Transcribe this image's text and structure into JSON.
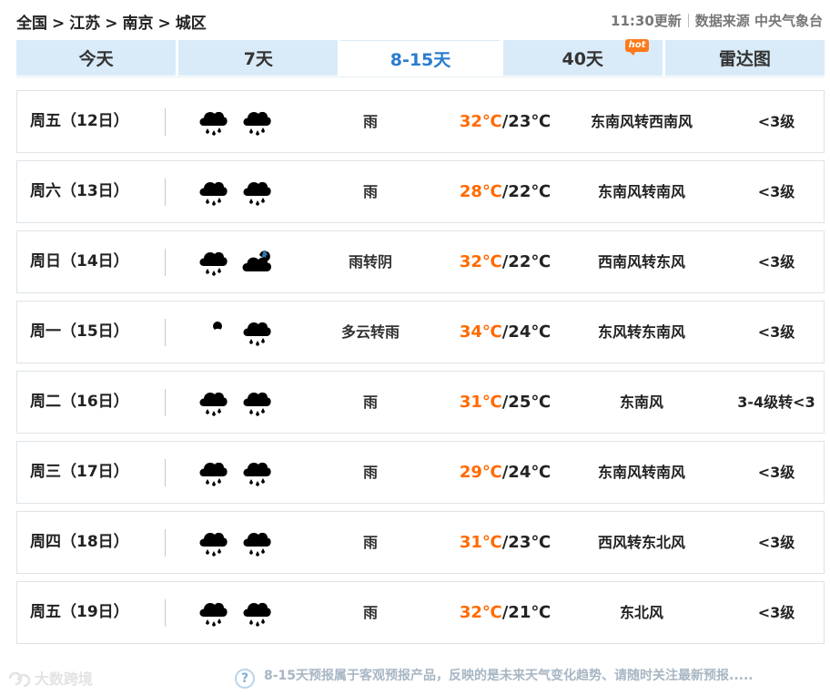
{
  "breadcrumb": {
    "items": [
      "全国",
      "江苏",
      "南京",
      "城区"
    ],
    "separator": ">"
  },
  "meta": {
    "update_time": "11:30更新",
    "source": "数据来源 中央气象台"
  },
  "tabs": [
    {
      "label": "今天",
      "active": false
    },
    {
      "label": "7天",
      "active": false
    },
    {
      "label": "8-15天",
      "active": true
    },
    {
      "label": "40天",
      "active": false,
      "badge": "hot"
    },
    {
      "label": "雷达图",
      "active": false
    }
  ],
  "forecast": [
    {
      "day": "周五（12日）",
      "icon1": "rain-icon",
      "icon2": "rain-icon",
      "desc": "雨",
      "high": "32℃",
      "low": "/23℃",
      "wind": "东南风转西南风",
      "level": "<3级"
    },
    {
      "day": "周六（13日）",
      "icon1": "rain-icon",
      "icon2": "rain-icon",
      "desc": "雨",
      "high": "28℃",
      "low": "/22℃",
      "wind": "东南风转南风",
      "level": "<3级"
    },
    {
      "day": "周日（14日）",
      "icon1": "rain-icon",
      "icon2": "overcast-icon",
      "desc": "雨转阴",
      "high": "32℃",
      "low": "/22℃",
      "wind": "西南风转东风",
      "level": "<3级"
    },
    {
      "day": "周一（15日）",
      "icon1": "partly-cloudy-icon",
      "icon2": "rain-icon",
      "desc": "多云转雨",
      "high": "34℃",
      "low": "/24℃",
      "wind": "东风转东南风",
      "level": "<3级"
    },
    {
      "day": "周二（16日）",
      "icon1": "rain-icon",
      "icon2": "rain-icon",
      "desc": "雨",
      "high": "31℃",
      "low": "/25℃",
      "wind": "东南风",
      "level": "3-4级转<3"
    },
    {
      "day": "周三（17日）",
      "icon1": "rain-icon",
      "icon2": "rain-icon",
      "desc": "雨",
      "high": "29℃",
      "low": "/24℃",
      "wind": "东南风转南风",
      "level": "<3级"
    },
    {
      "day": "周四（18日）",
      "icon1": "rain-icon",
      "icon2": "rain-icon",
      "desc": "雨",
      "high": "31℃",
      "low": "/23℃",
      "wind": "西风转东北风",
      "level": "<3级"
    },
    {
      "day": "周五（19日）",
      "icon1": "rain-icon",
      "icon2": "rain-icon",
      "desc": "雨",
      "high": "32℃",
      "low": "/21℃",
      "wind": "东北风",
      "level": "<3级"
    }
  ],
  "footer": {
    "help_icon": "?",
    "note": "8-15天预报属于客观预报产品，反映的是未来天气变化趋势、请随时关注最新预报.....",
    "watermark": "大数跨境"
  },
  "colors": {
    "tab_bg": "#d9ebf8",
    "active_tab_text": "#2a7ccd",
    "high_temp": "#ff6a00",
    "icon": "#3a86c8"
  }
}
